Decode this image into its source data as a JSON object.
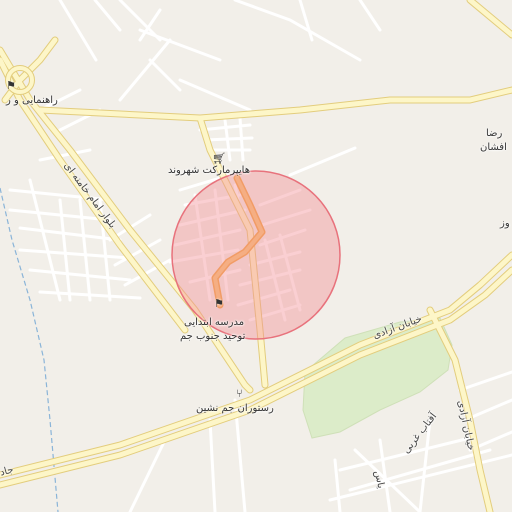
{
  "map": {
    "colors": {
      "background": "#f2efe9",
      "major_road": "#fdf6c8",
      "major_road_casing": "#e3cd7d",
      "minor_road": "#ffffff",
      "minor_road_casing": "#d8d3cb",
      "park": "#dcecc9",
      "route": "#f5b85c",
      "radius_fill": "#f28c93",
      "radius_stroke": "#e8727c",
      "water": "#8ab4d8"
    },
    "labels": {
      "hypermarket": "هایپرمارکت شهروند",
      "navigation": "راهنمایی و ر",
      "reza_line1": "رضا",
      "reza_line2": "افشان",
      "edge_mouz": "وز",
      "school_line1": "مدرسه ابتدایی",
      "school_line2": "توحید جنوب جم",
      "restaurant": "رستوران جم نشین",
      "street_azadi": "خیابان آزادی",
      "street_azadi_2": "خیابان آزادی",
      "blvd_imam": "بلوار امام خامنه ای",
      "aftab_gharbi": "آفتاب غربی",
      "yas": "یاس",
      "edge_jade": "جاد"
    },
    "icons": {
      "hypermarket": "shopping-cart-icon",
      "navigation": "police-icon",
      "school": "school-icon",
      "restaurant": "restaurant-icon"
    }
  }
}
